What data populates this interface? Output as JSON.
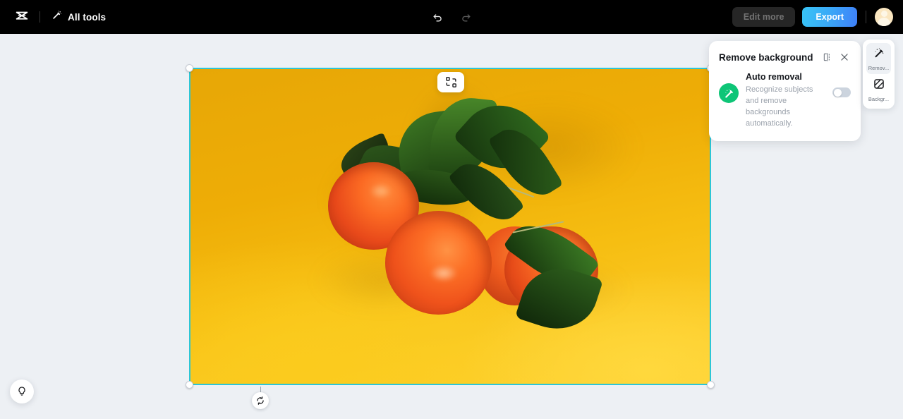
{
  "app": {
    "logo_icon": "capcut-logo-icon",
    "all_tools_label": "All tools",
    "all_tools_icon": "magic-wand-icon"
  },
  "header": {
    "undo_icon": "undo-icon",
    "redo_icon": "redo-icon",
    "edit_more_label": "Edit more",
    "export_label": "Export",
    "avatar_name": "user-avatar"
  },
  "canvas": {
    "toolbar_icon": "replace-media-icon",
    "rotate_icon": "rotate-handle-icon",
    "selection_color": "#2dc6d6",
    "image_alt": "three mandarin oranges with green leaves on yellow background"
  },
  "remove_background_panel": {
    "title": "Remove background",
    "compare_icon": "compare-split-icon",
    "close_icon": "close-icon",
    "auto_removal": {
      "icon": "magic-wand-badge-icon",
      "title": "Auto removal",
      "description": "Recognize subjects and remove backgrounds automatically.",
      "toggle_state": "off",
      "badge_color": "#0ec577"
    }
  },
  "right_rail": {
    "items": [
      {
        "label": "Remov...",
        "icon": "magic-wand-icon",
        "active": true
      },
      {
        "label": "Backgr...",
        "icon": "background-pattern-icon",
        "active": false
      }
    ]
  },
  "tips": {
    "icon": "lightbulb-icon"
  }
}
